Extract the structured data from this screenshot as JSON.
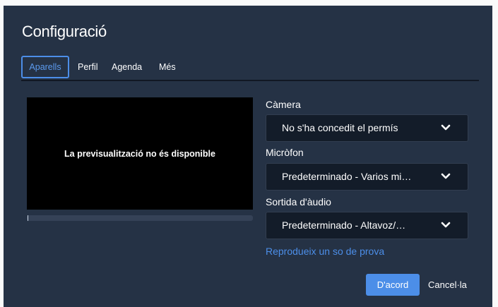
{
  "dialog": {
    "title": "Configuració"
  },
  "tabs": [
    {
      "label": "Aparells",
      "active": true
    },
    {
      "label": "Perfil",
      "active": false
    },
    {
      "label": "Agenda",
      "active": false
    },
    {
      "label": "Més",
      "active": false
    }
  ],
  "preview": {
    "message": "La previsualització no és disponible"
  },
  "camera": {
    "label": "Càmera",
    "value": "No s'ha concedit el permís"
  },
  "microphone": {
    "label": "Micròfon",
    "value": "Predeterminado - Varios mi…"
  },
  "audio_output": {
    "label": "Sortida d'àudio",
    "value": "Predeterminado - Altavoz/…"
  },
  "test_sound_link": "Reprodueix un so de prova",
  "buttons": {
    "ok": "D'acord",
    "cancel": "Cancel·la"
  },
  "icons": {
    "select_chevron": "chevron-down-icon"
  },
  "colors": {
    "dialog_bg": "#253245",
    "accent": "#4c8ee8",
    "select_bg": "#131c29"
  }
}
